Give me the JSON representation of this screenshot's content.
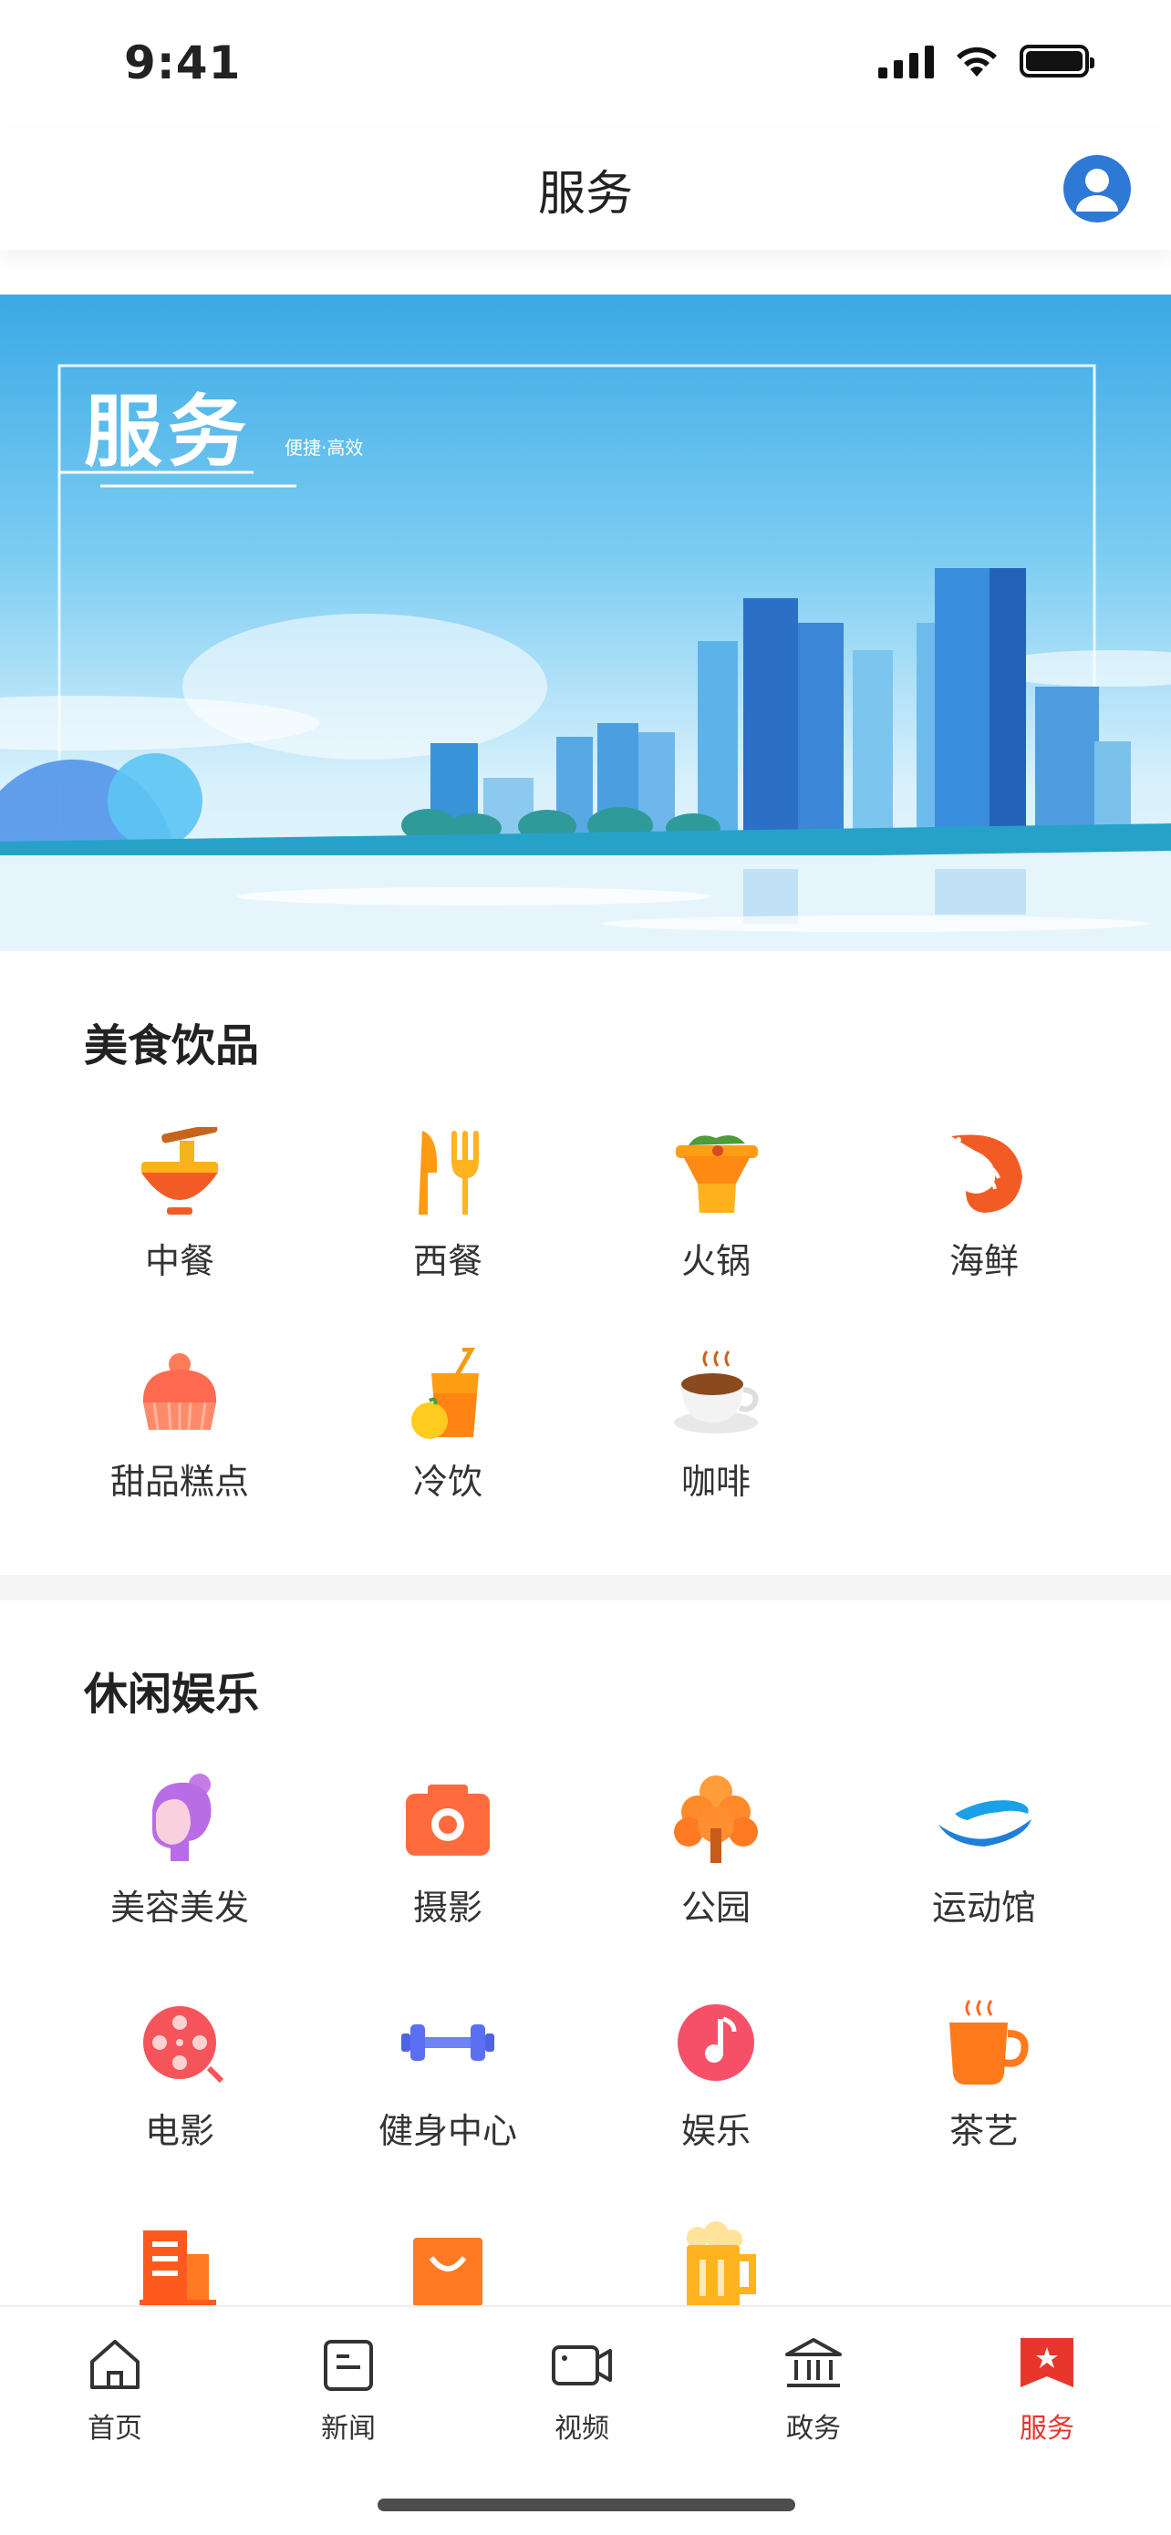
{
  "status": {
    "time": "9:41"
  },
  "header": {
    "title": "服务"
  },
  "banner": {
    "title": "服务",
    "subtitle": "便捷·高效"
  },
  "sections": [
    {
      "title": "美食饮品",
      "items": [
        {
          "label": "中餐",
          "icon": "noodle-bowl-icon"
        },
        {
          "label": "西餐",
          "icon": "fork-knife-icon"
        },
        {
          "label": "火锅",
          "icon": "hotpot-icon"
        },
        {
          "label": "海鲜",
          "icon": "shrimp-icon"
        },
        {
          "label": "甜品糕点",
          "icon": "cake-icon"
        },
        {
          "label": "冷饮",
          "icon": "cold-drink-icon"
        },
        {
          "label": "咖啡",
          "icon": "coffee-cup-icon"
        }
      ]
    },
    {
      "title": "休闲娱乐",
      "items": [
        {
          "label": "美容美发",
          "icon": "hair-salon-icon"
        },
        {
          "label": "摄影",
          "icon": "camera-icon"
        },
        {
          "label": "公园",
          "icon": "tree-icon"
        },
        {
          "label": "运动馆",
          "icon": "wave-icon"
        },
        {
          "label": "电影",
          "icon": "film-reel-icon"
        },
        {
          "label": "健身中心",
          "icon": "dumbbell-icon"
        },
        {
          "label": "娱乐",
          "icon": "music-note-icon"
        },
        {
          "label": "茶艺",
          "icon": "tea-cup-icon"
        },
        {
          "label": "",
          "icon": "building-icon"
        },
        {
          "label": "",
          "icon": "shopping-bag-icon"
        },
        {
          "label": "",
          "icon": "beer-mug-icon"
        }
      ]
    }
  ],
  "tabbar": [
    {
      "label": "首页",
      "icon": "home-icon",
      "active": false
    },
    {
      "label": "新闻",
      "icon": "news-icon",
      "active": false
    },
    {
      "label": "视频",
      "icon": "video-icon",
      "active": false
    },
    {
      "label": "政务",
      "icon": "government-icon",
      "active": false
    },
    {
      "label": "服务",
      "icon": "service-bookmark-icon",
      "active": true
    }
  ],
  "colors": {
    "accent": "#e8362d",
    "brand_blue": "#2e79d6",
    "icon_orange": "#f25c24"
  }
}
